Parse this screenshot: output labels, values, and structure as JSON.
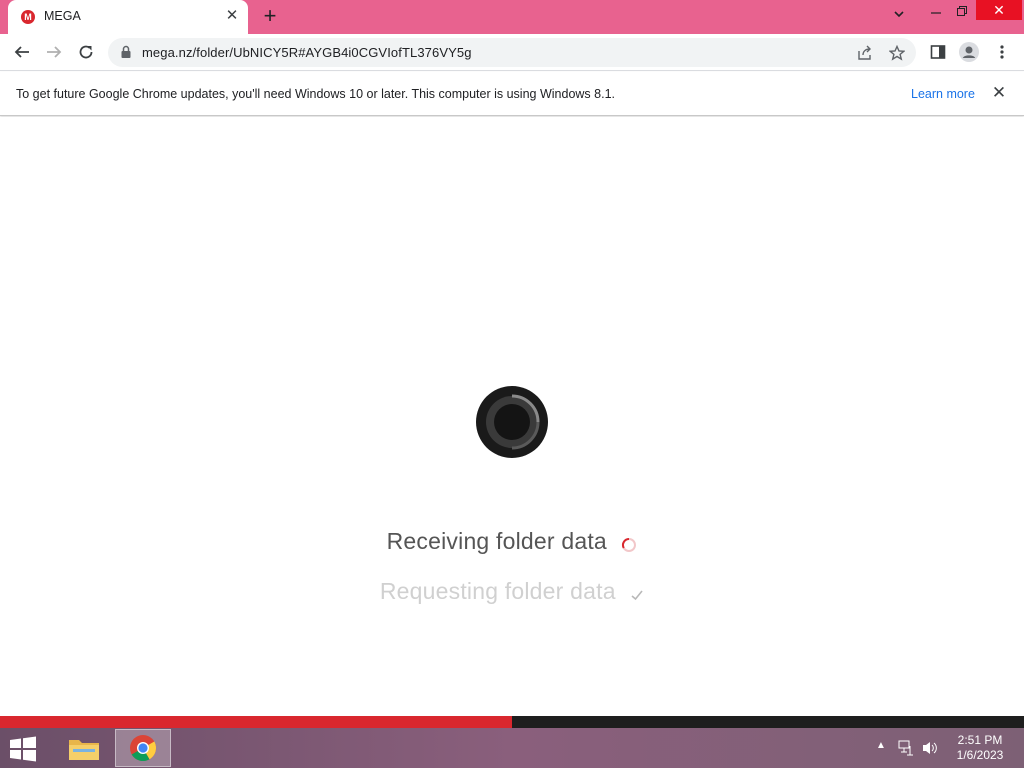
{
  "browser": {
    "tab": {
      "favicon_letter": "M",
      "title": "MEGA"
    },
    "new_tab_label": "+",
    "url": "mega.nz/folder/UbNICY5R#AYGB4i0CGVIofTL376VY5g"
  },
  "infobar": {
    "message": "To get future Google Chrome updates, you'll need Windows 10 or later. This computer is using Windows 8.1.",
    "link": "Learn more"
  },
  "page": {
    "status_active": "Receiving folder data",
    "status_done": "Requesting folder data",
    "progress_fraction": 0.5
  },
  "taskbar": {
    "time": "2:51 PM",
    "date": "1/6/2023"
  },
  "colors": {
    "titlebar": "#e8628f",
    "mega_red": "#d9272e",
    "link_blue": "#1a73e8"
  }
}
